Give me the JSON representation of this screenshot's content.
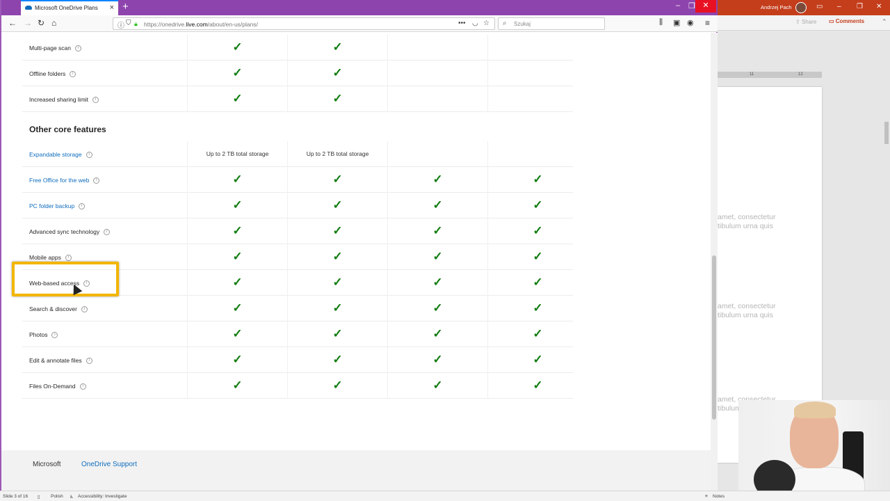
{
  "browser": {
    "tab_title": "Microsoft OneDrive Plans",
    "url_prefix": "https://onedrive.",
    "url_domain": "live.com",
    "url_path": "/about/en-us/plans/",
    "search_placeholder": "Szukaj"
  },
  "table": {
    "top_rows": [
      {
        "label": "Multi-page scan",
        "link": false,
        "cells": [
          "check",
          "check",
          "",
          ""
        ]
      },
      {
        "label": "Offline folders",
        "link": false,
        "cells": [
          "check",
          "check",
          "",
          ""
        ]
      },
      {
        "label": "Increased sharing limit",
        "link": false,
        "cells": [
          "check",
          "check",
          "",
          ""
        ]
      }
    ],
    "section_title": "Other core features",
    "rows": [
      {
        "label": "Expandable storage",
        "link": true,
        "cells": [
          "Up to 2 TB total storage",
          "Up to 2 TB total storage",
          "",
          ""
        ]
      },
      {
        "label": "Free Office for the web",
        "link": true,
        "cells": [
          "check",
          "check",
          "check",
          "check"
        ]
      },
      {
        "label": "PC folder backup",
        "link": true,
        "cells": [
          "check",
          "check",
          "check",
          "check"
        ]
      },
      {
        "label": "Advanced sync technology",
        "link": false,
        "cells": [
          "check",
          "check",
          "check",
          "check"
        ]
      },
      {
        "label": "Mobile apps",
        "link": false,
        "cells": [
          "check",
          "check",
          "check",
          "check"
        ]
      },
      {
        "label": "Web-based access",
        "link": false,
        "cells": [
          "check",
          "check",
          "check",
          "check"
        ]
      },
      {
        "label": "Search & discover",
        "link": false,
        "cells": [
          "check",
          "check",
          "check",
          "check"
        ]
      },
      {
        "label": "Photos",
        "link": false,
        "cells": [
          "check",
          "check",
          "check",
          "check"
        ]
      },
      {
        "label": "Edit & annotate files",
        "link": false,
        "cells": [
          "check",
          "check",
          "check",
          "check"
        ]
      },
      {
        "label": "Files On-Demand",
        "link": false,
        "cells": [
          "check",
          "check",
          "check",
          "check"
        ]
      }
    ]
  },
  "footer": {
    "microsoft": "Microsoft",
    "support": "OneDrive Support"
  },
  "powerpoint": {
    "user_name": "Andrzej Pach",
    "share_label": "Share",
    "comments_label": "Comments",
    "ruler_11": "11",
    "ruler_12": "12",
    "slide_text": [
      [
        "amet, consectetur",
        "tibulum urna quis"
      ],
      [
        "amet, consectetur",
        "tibulum urna quis"
      ],
      [
        "amet, consectetur",
        "tibulum urna quis"
      ]
    ],
    "status": {
      "slide": "Slide 3 of 16",
      "language": "Polish",
      "accessibility": "Accessibility: Investigate",
      "notes": "Notes"
    }
  },
  "colors": {
    "check": "#107c10",
    "link": "#0f6cbd",
    "highlight": "#f2b600",
    "tabbar": "#8e44ad",
    "ppt_titlebar": "#c43e1c"
  }
}
